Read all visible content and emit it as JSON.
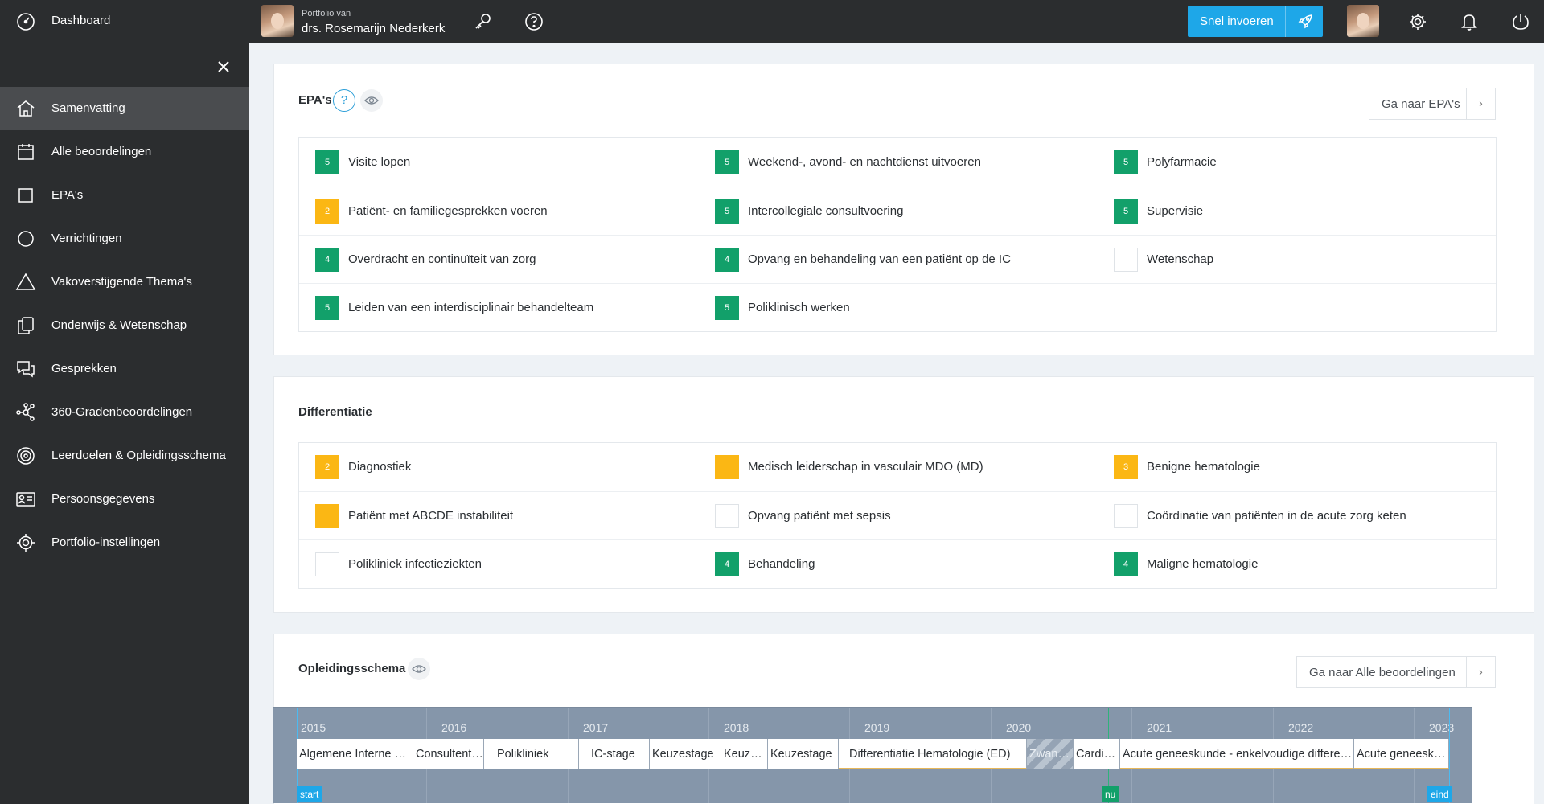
{
  "topbar": {
    "dashboard_label": "Dashboard",
    "portfolio_small": "Portfolio van",
    "portfolio_name": "drs. Rosemarijn Nederkerk",
    "snel_label": "Snel invoeren"
  },
  "sidebar": {
    "items": [
      {
        "label": "Samenvatting",
        "icon": "home-icon",
        "active": true
      },
      {
        "label": "Alle beoordelingen",
        "icon": "calendar-icon"
      },
      {
        "label": "EPA's",
        "icon": "square-icon"
      },
      {
        "label": "Verrichtingen",
        "icon": "circle-icon"
      },
      {
        "label": "Vakoverstijgende Thema's",
        "icon": "triangle-icon"
      },
      {
        "label": "Onderwijs & Wetenschap",
        "icon": "documents-icon"
      },
      {
        "label": "Gesprekken",
        "icon": "chat-icon"
      },
      {
        "label": "360-Gradenbeoordelingen",
        "icon": "network-icon"
      },
      {
        "label": "Leerdoelen & Opleidingsschema",
        "icon": "target-icon"
      },
      {
        "label": "Persoonsgegevens",
        "icon": "id-card-icon"
      },
      {
        "label": "Portfolio-instellingen",
        "icon": "gear-icon"
      }
    ]
  },
  "epas": {
    "title": "EPA's",
    "help": "?",
    "goto_label": "Ga naar EPA's",
    "items": [
      {
        "label": "Visite lopen",
        "level": "5",
        "color": "#12a06a"
      },
      {
        "label": "Weekend-, avond- en nachtdienst uitvoeren",
        "level": "5",
        "color": "#12a06a"
      },
      {
        "label": "Polyfarmacie",
        "level": "5",
        "color": "#12a06a"
      },
      {
        "label": "Patiënt- en familiegesprekken voeren",
        "level": "2",
        "color": "#fbb714"
      },
      {
        "label": "Intercollegiale consultvoering",
        "level": "5",
        "color": "#12a06a"
      },
      {
        "label": "Supervisie",
        "level": "5",
        "color": "#12a06a"
      },
      {
        "label": "Overdracht en continuïteit van zorg",
        "level": "4",
        "color": "#12a06a"
      },
      {
        "label": "Opvang en behandeling van een patiënt op de IC",
        "level": "4",
        "color": "#12a06a"
      },
      {
        "label": "Wetenschap",
        "level": "",
        "color": ""
      },
      {
        "label": "Leiden van een interdisciplinair behandelteam",
        "level": "5",
        "color": "#12a06a"
      },
      {
        "label": "Poliklinisch werken",
        "level": "5",
        "color": "#12a06a"
      }
    ]
  },
  "differentiatie": {
    "title": "Differentiatie",
    "items": [
      {
        "label": "Diagnostiek",
        "level": "2",
        "color": "#fbb714"
      },
      {
        "label": "Medisch leiderschap in vasculair MDO (MD)",
        "level": "",
        "color": "#fbb714"
      },
      {
        "label": "Benigne hematologie",
        "level": "3",
        "color": "#fbb714"
      },
      {
        "label": "Patiënt met ABCDE instabiliteit",
        "level": "",
        "color": "#fbb714"
      },
      {
        "label": "Opvang patiënt met sepsis",
        "level": "",
        "color": ""
      },
      {
        "label": "Coördinatie van patiënten in de acute zorg keten",
        "level": "",
        "color": ""
      },
      {
        "label": "Polikliniek infectieziekten",
        "level": "",
        "color": ""
      },
      {
        "label": "Behandeling",
        "level": "4",
        "color": "#12a06a"
      },
      {
        "label": "Maligne hematologie",
        "level": "4",
        "color": "#12a06a"
      }
    ]
  },
  "opleidingsschema": {
    "title": "Opleidingsschema",
    "goto_label": "Ga naar Alle beoordelingen",
    "years": [
      "2015",
      "2016",
      "2017",
      "2018",
      "2019",
      "2020",
      "2021",
      "2022",
      "2023"
    ],
    "segments": [
      {
        "label": "Algemene Interne Geneeskunde"
      },
      {
        "label": "Consultentschap"
      },
      {
        "label": "Polikliniek"
      },
      {
        "label": "IC-stage"
      },
      {
        "label": "Keuzestage"
      },
      {
        "label": "Keuzestage"
      },
      {
        "label": "Keuzestage"
      },
      {
        "label": "Differentiatie Hematologie (ED)"
      },
      {
        "label": "Zwangerschapsverlof"
      },
      {
        "label": "Cardiologie"
      },
      {
        "label": "Acute geneeskunde - enkelvoudige differentiatie"
      },
      {
        "label": "Acute geneeskunde"
      }
    ],
    "markers": {
      "start": "start",
      "nu": "nu",
      "eind": "eind"
    }
  }
}
